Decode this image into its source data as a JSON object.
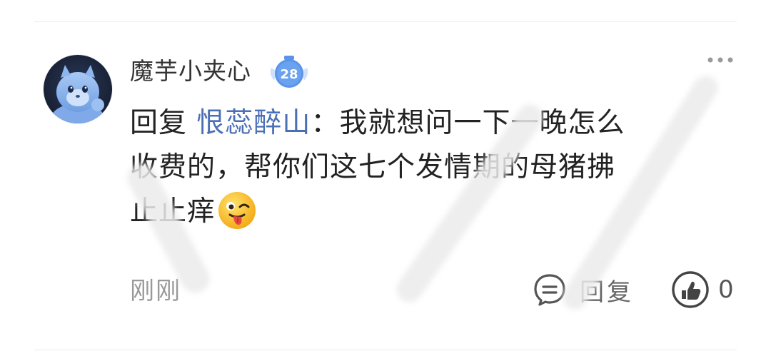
{
  "comment": {
    "username": "魔芋小夹心",
    "level": "28",
    "reply_prefix": "回复",
    "mention": "恨蕊醉山",
    "separator": "：",
    "text_line1": "我就想问一下一晚怎么",
    "text_line2": "收费的，帮你们这七个发情期的母猪拂",
    "text_line3": "止止痒",
    "emoji": "tongue-wink-emoji",
    "timestamp": "刚刚"
  },
  "actions": {
    "reply_label": "回复",
    "like_count": "0"
  },
  "icons": {
    "more": "more-dots-icon",
    "reply": "comment-bubble-icon",
    "like": "thumbs-up-icon",
    "badge": "level-badge-icon"
  },
  "colors": {
    "mention": "#4a6fb5",
    "badge": "#5b93e8",
    "muted": "#999999",
    "text": "#222222"
  }
}
